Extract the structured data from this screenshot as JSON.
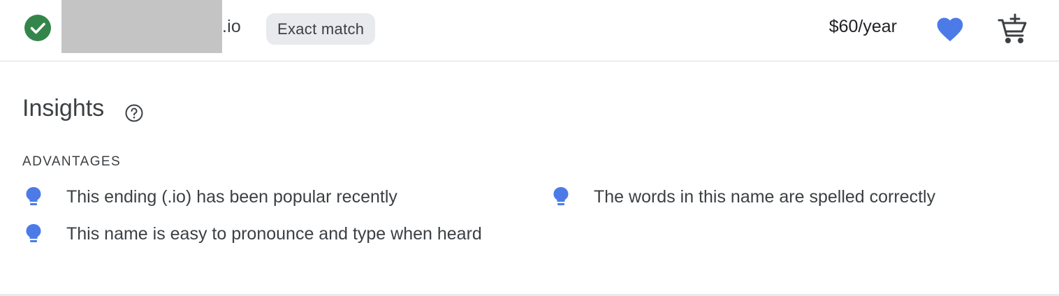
{
  "result": {
    "domain_suffix": ".io",
    "match_label": "Exact match",
    "price": "$60/year",
    "status": "available",
    "accent_color": "#4c7be8",
    "status_color": "#34854a"
  },
  "insights": {
    "title": "Insights",
    "section_label": "ADVANTAGES",
    "advantages": [
      "This ending (.io) has been popular recently",
      "The words in this name are spelled correctly",
      "This name is easy to pronounce and type when heard"
    ]
  },
  "icons": {
    "status": "check-circle-icon",
    "favorite": "heart-icon",
    "cart": "add-to-cart-icon",
    "help": "help-circle-icon",
    "bullet": "lightbulb-icon"
  }
}
